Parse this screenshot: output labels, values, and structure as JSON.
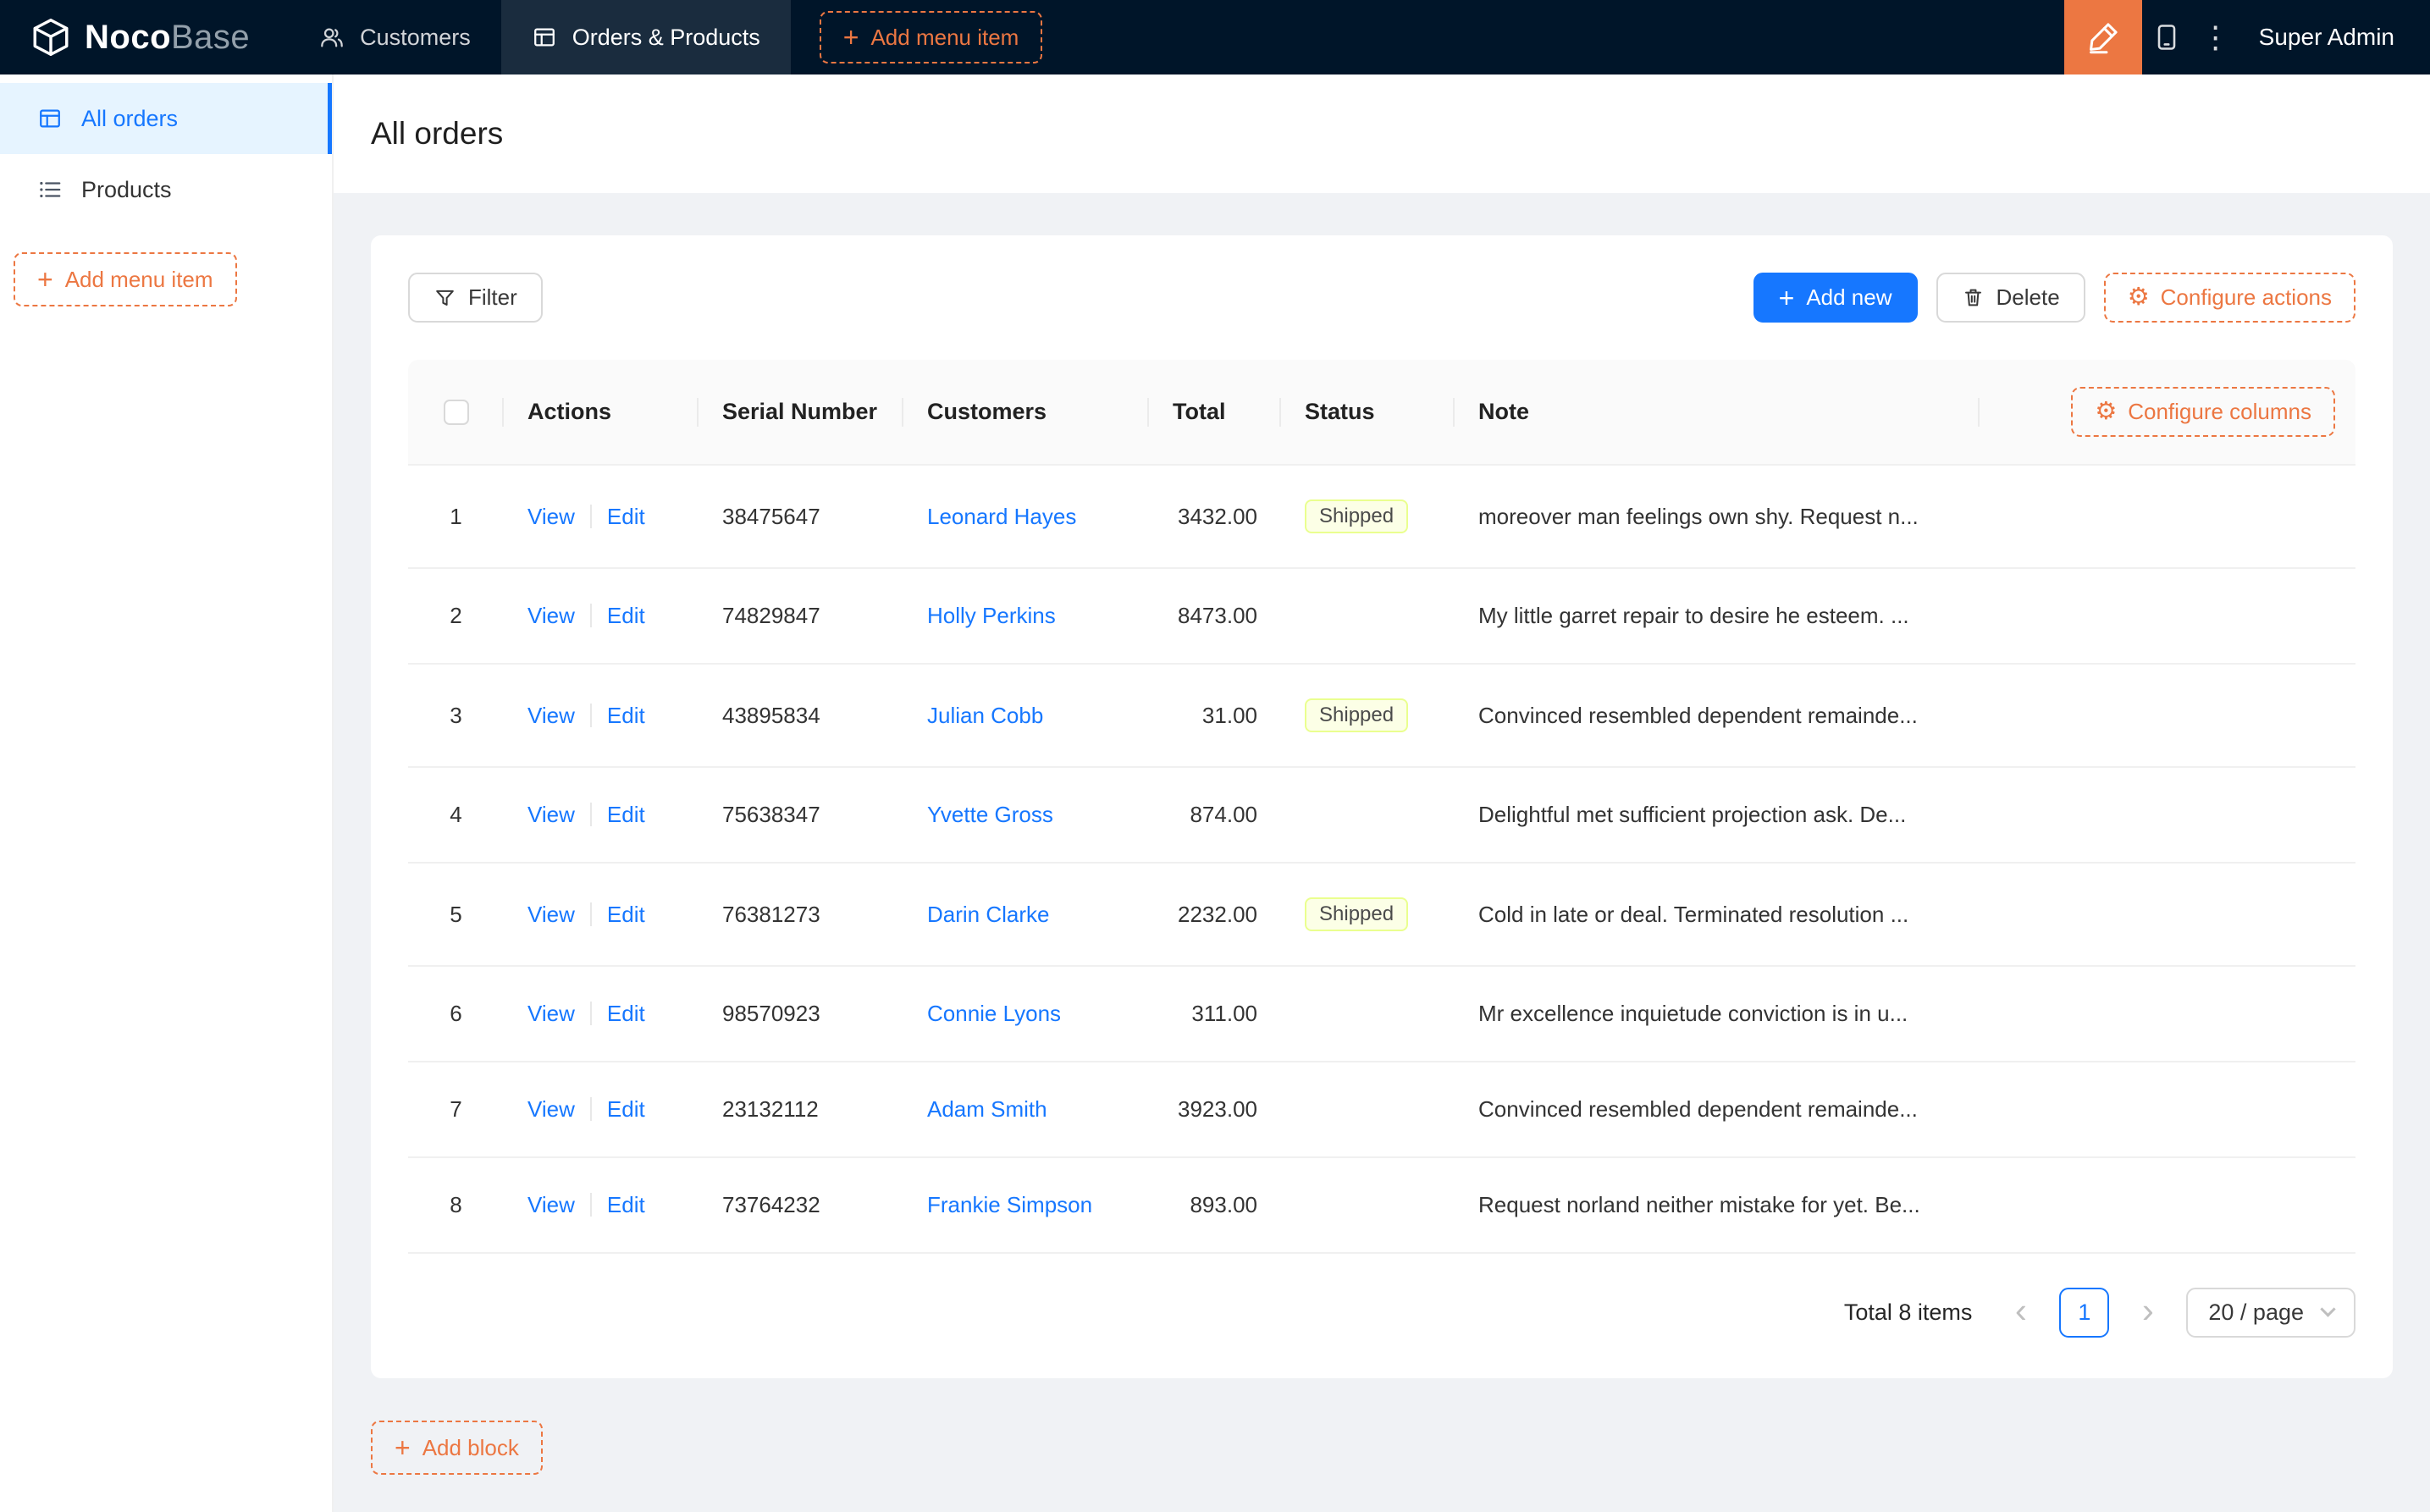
{
  "colors": {
    "navbar_bg": "#001529",
    "accent_orange": "#ec7742",
    "primary_blue": "#1677ff",
    "page_bg": "#f0f2f5",
    "sidebar_active_bg": "#e6f4ff",
    "tag_shipped_bg": "#fcffe6",
    "tag_shipped_border": "#eaff8f",
    "tag_shipped_text": "#4b4b4b"
  },
  "icons": {
    "plus": "+",
    "gear": "⚙",
    "more": "⋮",
    "prev": "‹",
    "next": "›"
  },
  "navbar": {
    "logo_primary": "Noco",
    "logo_secondary": "Base",
    "tabs": [
      {
        "label": "Customers",
        "icon": "users-icon",
        "active": false
      },
      {
        "label": "Orders & Products",
        "icon": "table-icon",
        "active": true
      }
    ],
    "add_menu_item_label": "Add menu item",
    "user": "Super Admin"
  },
  "sidebar": {
    "items": [
      {
        "label": "All orders",
        "icon": "table-icon",
        "active": true
      },
      {
        "label": "Products",
        "icon": "list-icon",
        "active": false
      }
    ],
    "add_menu_item_label": "Add menu item"
  },
  "page": {
    "title": "All orders"
  },
  "toolbar": {
    "filter": "Filter",
    "add_new": "Add new",
    "delete": "Delete",
    "configure_actions": "Configure actions"
  },
  "table": {
    "configure_columns": "Configure columns",
    "columns": {
      "actions": "Actions",
      "serial": "Serial Number",
      "customers": "Customers",
      "total": "Total",
      "status": "Status",
      "note": "Note"
    },
    "view": "View",
    "edit": "Edit",
    "rows": [
      {
        "n": "1",
        "serial": "38475647",
        "customer": "Leonard Hayes",
        "total": "3432.00",
        "status": "Shipped",
        "note": "moreover man feelings own shy. Request n..."
      },
      {
        "n": "2",
        "serial": "74829847",
        "customer": "Holly Perkins",
        "total": "8473.00",
        "status": "",
        "note": "My little garret repair to desire he esteem. ..."
      },
      {
        "n": "3",
        "serial": "43895834",
        "customer": "Julian Cobb",
        "total": "31.00",
        "status": "Shipped",
        "note": "Convinced resembled dependent remainde..."
      },
      {
        "n": "4",
        "serial": "75638347",
        "customer": "Yvette Gross",
        "total": "874.00",
        "status": "",
        "note": "Delightful met sufficient projection ask. De..."
      },
      {
        "n": "5",
        "serial": "76381273",
        "customer": "Darin Clarke",
        "total": "2232.00",
        "status": "Shipped",
        "note": "Cold in late or deal. Terminated resolution ..."
      },
      {
        "n": "6",
        "serial": "98570923",
        "customer": "Connie Lyons",
        "total": "311.00",
        "status": "",
        "note": "Mr excellence inquietude conviction is in u..."
      },
      {
        "n": "7",
        "serial": "23132112",
        "customer": "Adam Smith",
        "total": "3923.00",
        "status": "",
        "note": "Convinced resembled dependent remainde..."
      },
      {
        "n": "8",
        "serial": "73764232",
        "customer": "Frankie Simpson",
        "total": "893.00",
        "status": "",
        "note": "Request norland neither mistake for yet. Be..."
      }
    ]
  },
  "pagination": {
    "total": "Total 8 items",
    "page": "1",
    "page_size": "20 / page"
  },
  "add_block_label": "Add block"
}
